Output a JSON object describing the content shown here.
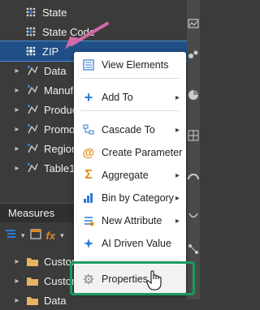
{
  "tree": {
    "items": [
      {
        "label": "State",
        "kind": "geo"
      },
      {
        "label": "State Code",
        "kind": "geo"
      },
      {
        "label": "ZIP",
        "kind": "geo",
        "selected": true
      },
      {
        "label": "Data",
        "kind": "hier"
      },
      {
        "label": "Manufac",
        "kind": "hier"
      },
      {
        "label": "Products",
        "kind": "hier"
      },
      {
        "label": "Promotio",
        "kind": "hier"
      },
      {
        "label": "Region I",
        "kind": "hier"
      },
      {
        "label": "Table1",
        "kind": "hier"
      }
    ]
  },
  "measures": {
    "header": "Measures",
    "items": [
      {
        "label": "Custom"
      },
      {
        "label": "Custome"
      },
      {
        "label": "Data"
      }
    ]
  },
  "context_menu": {
    "items": [
      {
        "label": "View Elements",
        "icon": "list-icon",
        "submenu": false
      },
      {
        "label": "Add To",
        "icon": "plus-icon",
        "submenu": true
      },
      {
        "label": "Cascade To",
        "icon": "cascade-icon",
        "submenu": true
      },
      {
        "label": "Create Parameter",
        "icon": "at-icon",
        "submenu": false
      },
      {
        "label": "Aggregate",
        "icon": "sigma-icon",
        "submenu": true
      },
      {
        "label": "Bin by Category",
        "icon": "bin-icon",
        "submenu": true
      },
      {
        "label": "New Attribute",
        "icon": "attribute-icon",
        "submenu": true
      },
      {
        "label": "AI Driven Value",
        "icon": "ai-icon",
        "submenu": false
      },
      {
        "label": "Properties",
        "icon": "gear-icon",
        "submenu": false
      }
    ]
  },
  "colors": {
    "panel_bg": "#3b3b3b",
    "selection": "#1f4f86",
    "highlight_border": "#1a9a60",
    "arrow": "#d26aa8",
    "accent_blue": "#2e7bd6",
    "accent_orange": "#e08a1e"
  }
}
